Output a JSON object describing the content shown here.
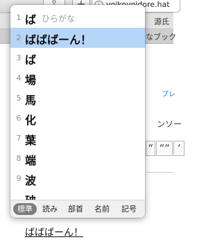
{
  "browser": {
    "url": "yoikoyoidore.hat",
    "share_icon": "share-icon",
    "add_tab_label": "+",
    "bookmarks": [
      "源氏"
    ],
    "tab_label": "なブック"
  },
  "page": {
    "link_text": "プレ",
    "body_text": "ンソー",
    "quote_buttons": [
      "“",
      "““",
      "‘"
    ],
    "composing_text": "ばばばーん！"
  },
  "ime": {
    "candidates": [
      {
        "number": "1",
        "text": "ば",
        "annotation": "ひらがな"
      },
      {
        "number": "2",
        "text": "ばばばーん！",
        "annotation": ""
      },
      {
        "number": "3",
        "text": "ば",
        "annotation": ""
      },
      {
        "number": "4",
        "text": "場",
        "annotation": ""
      },
      {
        "number": "5",
        "text": "馬",
        "annotation": ""
      },
      {
        "number": "6",
        "text": "化",
        "annotation": ""
      },
      {
        "number": "7",
        "text": "葉",
        "annotation": ""
      },
      {
        "number": "8",
        "text": "端",
        "annotation": ""
      },
      {
        "number": "9",
        "text": "波",
        "annotation": ""
      },
      {
        "number": "",
        "text": "破",
        "annotation": ""
      }
    ],
    "selected_index": 1,
    "sort_modes": [
      "標準",
      "読み",
      "部首",
      "名前",
      "記号"
    ],
    "active_sort_mode": 0
  }
}
